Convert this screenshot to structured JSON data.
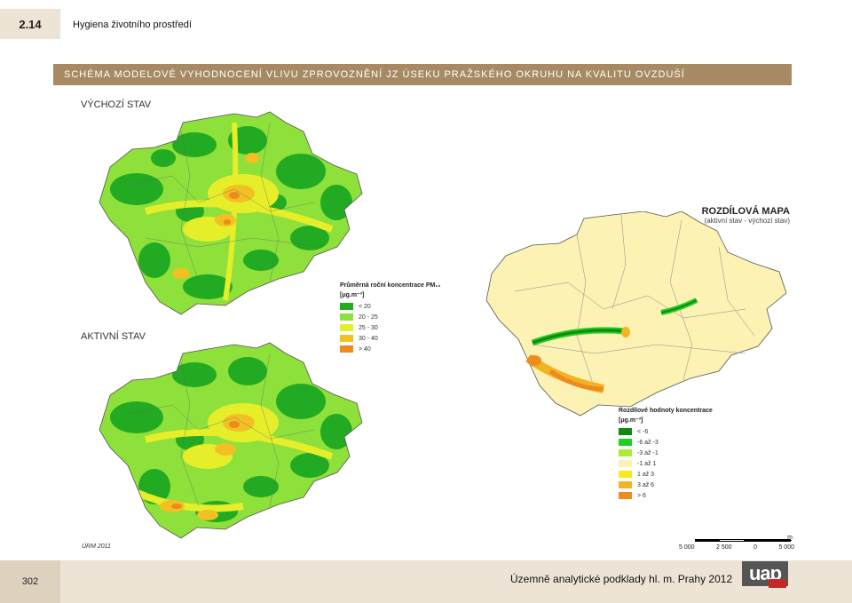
{
  "header": {
    "chapter_number": "2.14",
    "chapter_title": "Hygiena životního prostředí"
  },
  "heading": "SCHÉMA MODELOVÉ VYHODNOCENÍ VLIVU ZPROVOZNĚNÍ JZ ÚSEKU PRAŽSKÉHO OKRUHU NA KVALITU OVZDUŠÍ",
  "maps": {
    "initial_label": "VÝCHOZÍ STAV",
    "active_label": "AKTIVNÍ STAV",
    "diff_title": "ROZDÍLOVÁ MAPA",
    "diff_subtitle": "(aktivní stav - výchozí stav)"
  },
  "legend_pm": {
    "title": "Průměrná roční koncentrace PM₁₀",
    "unit": "[μg.m⁻³]",
    "items": [
      {
        "label": "< 20",
        "color": "#22aa22"
      },
      {
        "label": "20 - 25",
        "color": "#8ee03a"
      },
      {
        "label": "25 - 30",
        "color": "#e6ee2a"
      },
      {
        "label": "30 - 40",
        "color": "#f2c022"
      },
      {
        "label": "> 40",
        "color": "#ee8a1e"
      }
    ]
  },
  "legend_diff": {
    "title": "Rozdílové hodnoty koncentrace",
    "unit": "[μg.m⁻³]",
    "items": [
      {
        "label": "< -6",
        "color": "#118811"
      },
      {
        "label": "-6 až -3",
        "color": "#22cc22"
      },
      {
        "label": "-3 až -1",
        "color": "#aaee33"
      },
      {
        "label": "-1 až 1",
        "color": "#fbf2b4"
      },
      {
        "label": "1 až 3",
        "color": "#f6ea22"
      },
      {
        "label": "3 až 6",
        "color": "#f2b422"
      },
      {
        "label": "> 6",
        "color": "#ee8a1e"
      }
    ]
  },
  "source_note": "ÚRM 2011",
  "scale": {
    "unit": "m",
    "ticks": [
      "5 000",
      "2 500",
      "0",
      "5 000"
    ]
  },
  "footer": {
    "page_number": "302",
    "publication": "Územně analytické podklady hl. m. Prahy 2012",
    "logo_text": "uap"
  }
}
